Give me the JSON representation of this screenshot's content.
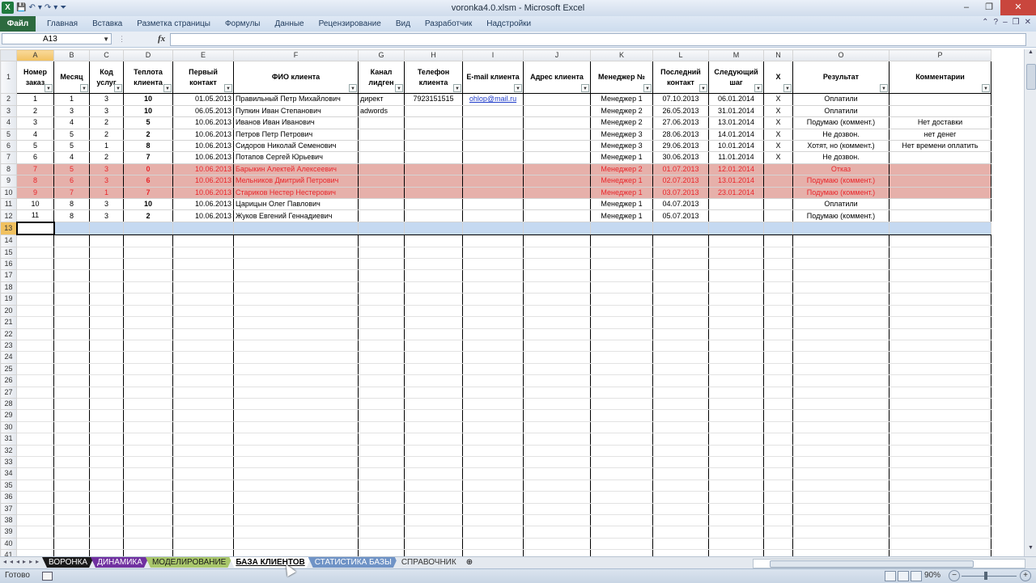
{
  "window": {
    "title": "voronka4.0.xlsm  -  Microsoft Excel",
    "app_icon": "X",
    "qat": [
      "save-icon",
      "undo-icon",
      "redo-icon",
      "customize-icon"
    ]
  },
  "ribbon": {
    "file_tab": "Файл",
    "tabs": [
      "Главная",
      "Вставка",
      "Разметка страницы",
      "Формулы",
      "Данные",
      "Рецензирование",
      "Вид",
      "Разработчик",
      "Надстройки"
    ]
  },
  "formula_bar": {
    "name_box": "A13",
    "fx": "fx",
    "value": ""
  },
  "columns": [
    "A",
    "B",
    "C",
    "D",
    "E",
    "F",
    "G",
    "H",
    "I",
    "J",
    "K",
    "L",
    "M",
    "N",
    "O",
    "P"
  ],
  "active_column": "A",
  "active_row": "13",
  "headers": [
    "Номер заказ",
    "Месяц",
    "Код услуг",
    "Теплота клиента",
    "Первый контакт",
    "ФИО клиента",
    "Канал лидген",
    "Телефон клиента",
    "E-mail клиента",
    "Адрес клиента",
    "Менеджер №",
    "Последний контакт",
    "Следующий шаг",
    "X",
    "Результат",
    "Комментарии"
  ],
  "rows": [
    {
      "row": "2",
      "style": "normal",
      "cells": [
        "1",
        "1",
        "3",
        "10",
        "01.05.2013",
        "Правильный Петр Михайлович",
        "директ",
        "7923151515",
        "ohlop@mail.ru",
        "",
        "Менеджер 1",
        "07.10.2013",
        "06.01.2014",
        "X",
        "Оплатили",
        ""
      ]
    },
    {
      "row": "3",
      "style": "normal",
      "cells": [
        "2",
        "3",
        "3",
        "10",
        "06.05.2013",
        "Пупкин Иван Степанович",
        "adwords",
        "",
        "",
        "",
        "Менеджер 2",
        "26.05.2013",
        "31.01.2014",
        "X",
        "Оплатили",
        ""
      ]
    },
    {
      "row": "4",
      "style": "normal",
      "cells": [
        "3",
        "4",
        "2",
        "5",
        "10.06.2013",
        "Иванов Иван Иванович",
        "",
        "",
        "",
        "",
        "Менеджер 2",
        "27.06.2013",
        "13.01.2014",
        "X",
        "Подумаю (коммент.)",
        "Нет доставки"
      ]
    },
    {
      "row": "5",
      "style": "normal",
      "cells": [
        "4",
        "5",
        "2",
        "2",
        "10.06.2013",
        "Петров Петр Петрович",
        "",
        "",
        "",
        "",
        "Менеджер 3",
        "28.06.2013",
        "14.01.2014",
        "X",
        "Не дозвон.",
        "нет денег"
      ]
    },
    {
      "row": "6",
      "style": "normal",
      "cells": [
        "5",
        "5",
        "1",
        "8",
        "10.06.2013",
        "Сидоров Николай Семенович",
        "",
        "",
        "",
        "",
        "Менеджер 3",
        "29.06.2013",
        "10.01.2014",
        "X",
        "Хотят, но (коммент.)",
        "Нет времени оплатить"
      ]
    },
    {
      "row": "7",
      "style": "normal",
      "cells": [
        "6",
        "4",
        "2",
        "7",
        "10.06.2013",
        "Потапов Сергей Юрьевич",
        "",
        "",
        "",
        "",
        "Менеджер 1",
        "30.06.2013",
        "11.01.2014",
        "X",
        "Не дозвон.",
        ""
      ]
    },
    {
      "row": "8",
      "style": "red",
      "cells": [
        "7",
        "5",
        "3",
        "0",
        "10.06.2013",
        "Барыкин Алектей Алексеевич",
        "",
        "",
        "",
        "",
        "Менеджер 2",
        "01.07.2013",
        "12.01.2014",
        "",
        "Отказ",
        ""
      ]
    },
    {
      "row": "9",
      "style": "red",
      "cells": [
        "8",
        "6",
        "3",
        "6",
        "10.06.2013",
        "Мельников Дмитрий Петрович",
        "",
        "",
        "",
        "",
        "Менеджер 1",
        "02.07.2013",
        "13.01.2014",
        "",
        "Подумаю (коммент.)",
        ""
      ]
    },
    {
      "row": "10",
      "style": "red",
      "cells": [
        "9",
        "7",
        "1",
        "7",
        "10.06.2013",
        "Стариков Нестер Нестерович",
        "",
        "",
        "",
        "",
        "Менеджер 1",
        "03.07.2013",
        "23.01.2014",
        "",
        "Подумаю (коммент.)",
        ""
      ]
    },
    {
      "row": "11",
      "style": "normal",
      "cells": [
        "10",
        "8",
        "3",
        "10",
        "10.06.2013",
        "Царицын Олег Павлович",
        "",
        "",
        "",
        "",
        "Менеджер 1",
        "04.07.2013",
        "",
        "",
        "Оплатили",
        ""
      ]
    },
    {
      "row": "12",
      "style": "normal",
      "cells": [
        "11",
        "8",
        "3",
        "2",
        "10.06.2013",
        "Жуков Евгений Геннадиевич",
        "",
        "",
        "",
        "",
        "Менеджер 1",
        "05.07.2013",
        "",
        "",
        "Подумаю (коммент.)",
        ""
      ]
    }
  ],
  "empty_rows": [
    "14",
    "15",
    "16",
    "17",
    "18",
    "19",
    "20",
    "21",
    "22",
    "23",
    "24",
    "25",
    "26",
    "27",
    "28",
    "29",
    "30",
    "31",
    "32",
    "33",
    "34",
    "35",
    "36",
    "37",
    "38",
    "39",
    "40",
    "41"
  ],
  "sheet_tabs": [
    {
      "label": "ВОРОНКА",
      "bg": "#1a1a1a",
      "fg": "#ffffff",
      "active": false
    },
    {
      "label": "ДИНАМИКА",
      "bg": "#7030a0",
      "fg": "#ffffff",
      "active": false
    },
    {
      "label": "МОДЕЛИРОВАНИЕ",
      "bg": "#a9c76b",
      "fg": "#1a1a1a",
      "active": false
    },
    {
      "label": "БАЗА КЛИЕНТОВ",
      "bg": "#ffffff",
      "fg": "#000000",
      "active": true
    },
    {
      "label": "СТАТИСТИКА БАЗЫ",
      "bg": "#6f93c6",
      "fg": "#ffffff",
      "active": false
    },
    {
      "label": "СПРАВОЧНИК",
      "bg": "#e4e9ef",
      "fg": "#333333",
      "active": false
    }
  ],
  "status": {
    "ready": "Готово",
    "zoom": "90%"
  }
}
